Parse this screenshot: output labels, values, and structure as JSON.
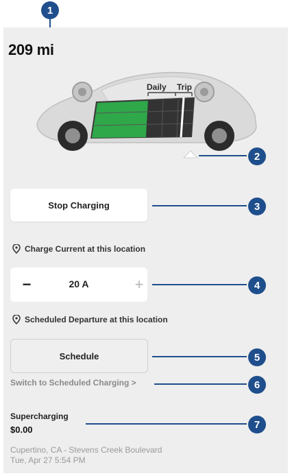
{
  "range": {
    "value": "209",
    "unit": "mi"
  },
  "battery": {
    "daily_label": "Daily",
    "trip_label": "Trip"
  },
  "actions": {
    "stop_charging": "Stop Charging",
    "schedule": "Schedule",
    "switch_link": "Switch to Scheduled Charging >"
  },
  "charge_current": {
    "label": "Charge Current at this location",
    "value": "20 A",
    "minus": "−",
    "plus": "+"
  },
  "departure": {
    "label": "Scheduled Departure at this location"
  },
  "supercharging": {
    "title": "Supercharging",
    "cost": "$0.00",
    "location": "Cupertino, CA - Stevens Creek Boulevard",
    "time": "Tue, Apr 27 5:54 PM"
  },
  "markers": [
    "1",
    "2",
    "3",
    "4",
    "5",
    "6",
    "7"
  ],
  "colors": {
    "marker": "#1f4e8c",
    "panel": "#eeeeee",
    "battery_charged": "#2fa84a"
  }
}
